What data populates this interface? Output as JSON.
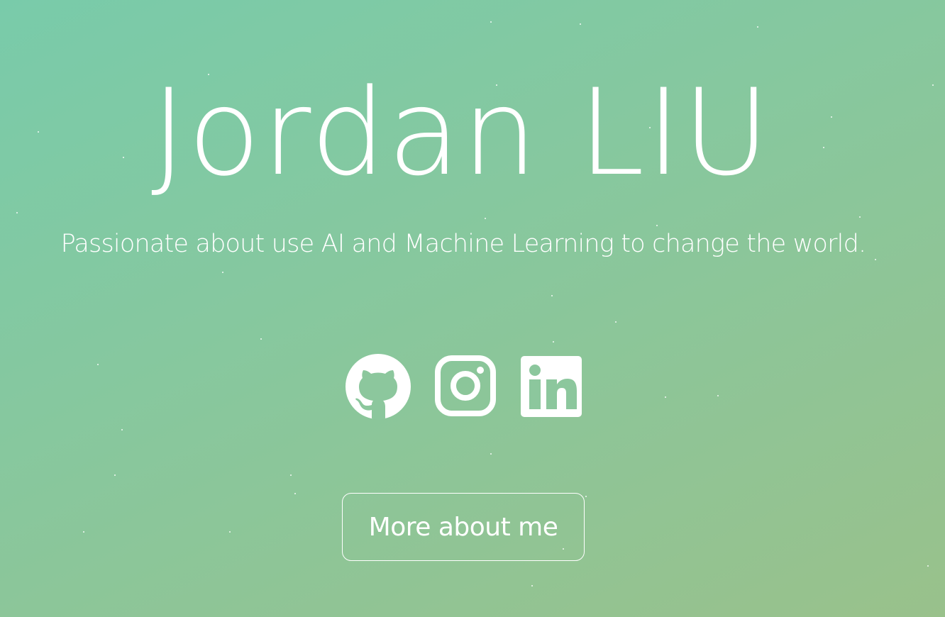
{
  "hero": {
    "name": "Jordan LIU",
    "tagline": "Passionate about use AI and Machine Learning to change the world."
  },
  "socials": [
    {
      "icon": "github-icon",
      "label": "GitHub"
    },
    {
      "icon": "instagram-icon",
      "label": "Instagram"
    },
    {
      "icon": "linkedin-icon",
      "label": "LinkedIn"
    }
  ],
  "cta": {
    "label": "More about me"
  },
  "colors": {
    "gradient_start": "#79cbaa",
    "gradient_end": "#99c18b",
    "text": "#ffffff"
  }
}
